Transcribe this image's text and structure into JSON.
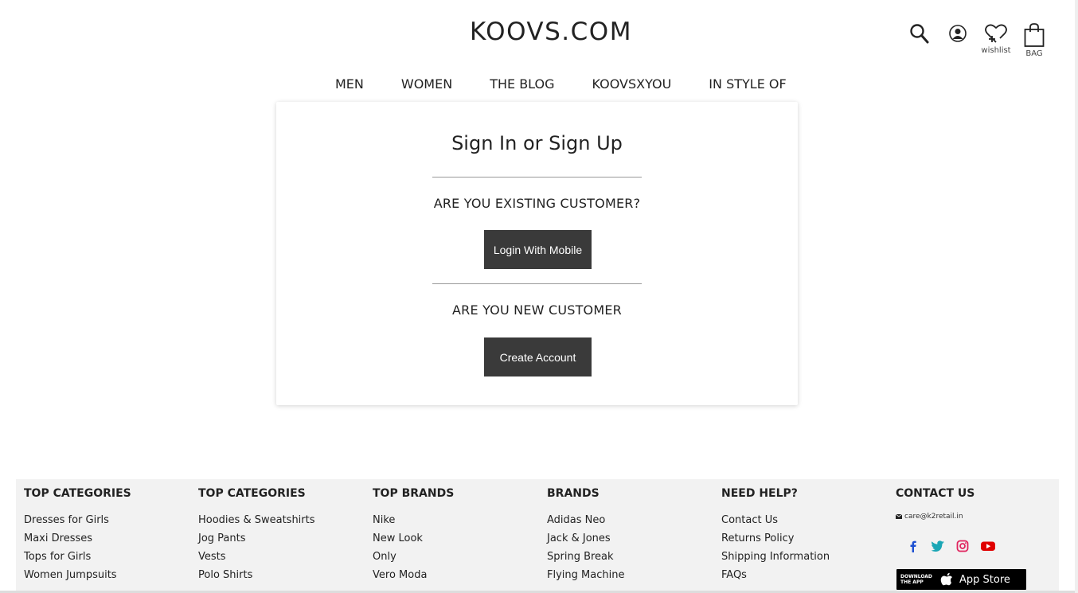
{
  "header": {
    "logo": "KOOVS.COM",
    "nav": [
      "MEN",
      "WOMEN",
      "THE BLOG",
      "KOOVSXYOU",
      "IN STYLE OF"
    ],
    "icons": {
      "search": "search-icon",
      "account": "account-icon",
      "wishlist": "wishlist",
      "bag": "BAG"
    }
  },
  "card": {
    "title": "Sign In or Sign Up",
    "existing_question": "ARE YOU EXISTING CUSTOMER?",
    "login_button": "Login With Mobile",
    "new_question": "ARE YOU NEW CUSTOMER",
    "create_button": "Create Account"
  },
  "footer": {
    "columns": [
      {
        "heading": "TOP CATEGORIES",
        "links": [
          "Dresses for Girls",
          "Maxi Dresses",
          "Tops for Girls",
          "Women Jumpsuits"
        ]
      },
      {
        "heading": "TOP CATEGORIES",
        "links": [
          "Hoodies & Sweatshirts",
          "Jog Pants",
          "Vests",
          "Polo Shirts"
        ]
      },
      {
        "heading": "TOP BRANDS",
        "links": [
          "Nike",
          "New Look",
          "Only",
          "Vero Moda"
        ]
      },
      {
        "heading": "BRANDS",
        "links": [
          "Adidas Neo",
          "Jack & Jones",
          "Spring Break",
          "Flying Machine"
        ]
      },
      {
        "heading": "NEED HELP?",
        "links": [
          "Contact Us",
          "Returns Policy",
          "Shipping Information",
          "FAQs"
        ]
      }
    ],
    "contact": {
      "heading": "CONTACT US",
      "email": "care@k2retail.in",
      "social": [
        "facebook-icon",
        "twitter-icon",
        "instagram-icon",
        "youtube-icon"
      ],
      "app_download": "DOWNLOAD THE APP",
      "app_store": "App Store"
    }
  },
  "colors": {
    "button_bg": "#3a3a3a",
    "footer_bg": "#f2f2f2",
    "facebook": "#1b4fd1",
    "twitter": "#1aa6b5",
    "instagram": "#e0245e",
    "youtube": "#e00000"
  }
}
